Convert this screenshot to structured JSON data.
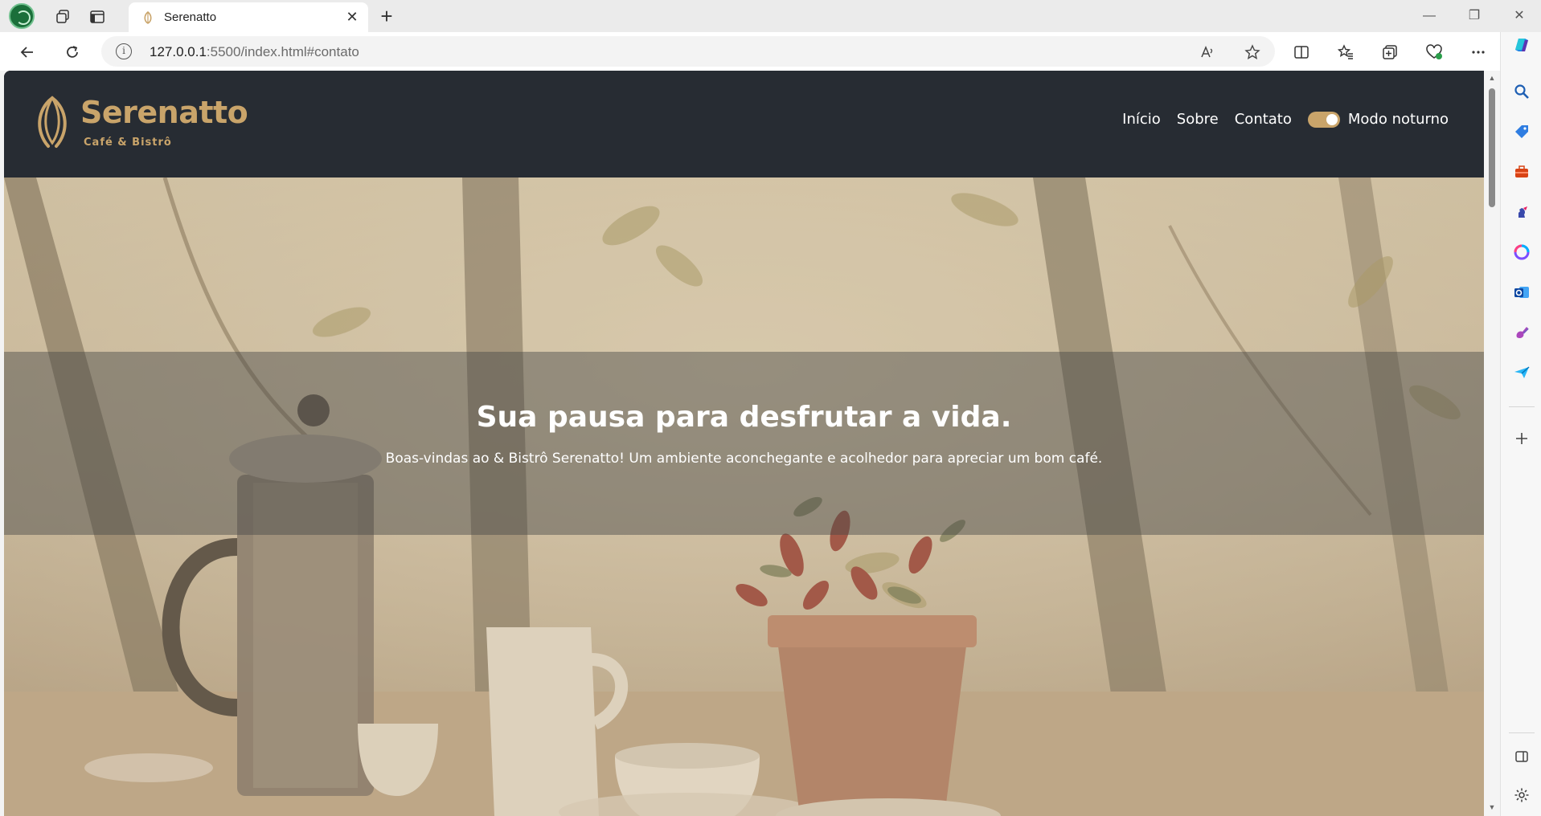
{
  "browser": {
    "tab_title": "Serenatto",
    "url_host": "127.0.0.1",
    "url_rest": ":5500/index.html#contato"
  },
  "site": {
    "logo_name": "Serenatto",
    "logo_sub": "Café & Bistrô",
    "nav": {
      "inicio": "Início",
      "sobre": "Sobre",
      "contato": "Contato",
      "dark_mode_label": "Modo noturno"
    },
    "dark_mode_on": true,
    "hero_title": "Sua pausa para desfrutar a vida.",
    "hero_subtitle": "Boas-vindas ao & Bistrô Serenatto! Um ambiente aconchegante e acolhedor para apreciar um bom café."
  },
  "colors": {
    "brand_gold": "#c9a46a",
    "header_bg": "#272c33",
    "profile_green": "#1b6f3a"
  },
  "icons": {
    "sidebar": [
      "search-icon",
      "tag-icon",
      "toolbox-icon",
      "chess-icon",
      "copilot-circle-icon",
      "outlook-icon",
      "designer-icon",
      "send-icon",
      "add-icon",
      "split-panel-icon",
      "settings-icon"
    ]
  }
}
